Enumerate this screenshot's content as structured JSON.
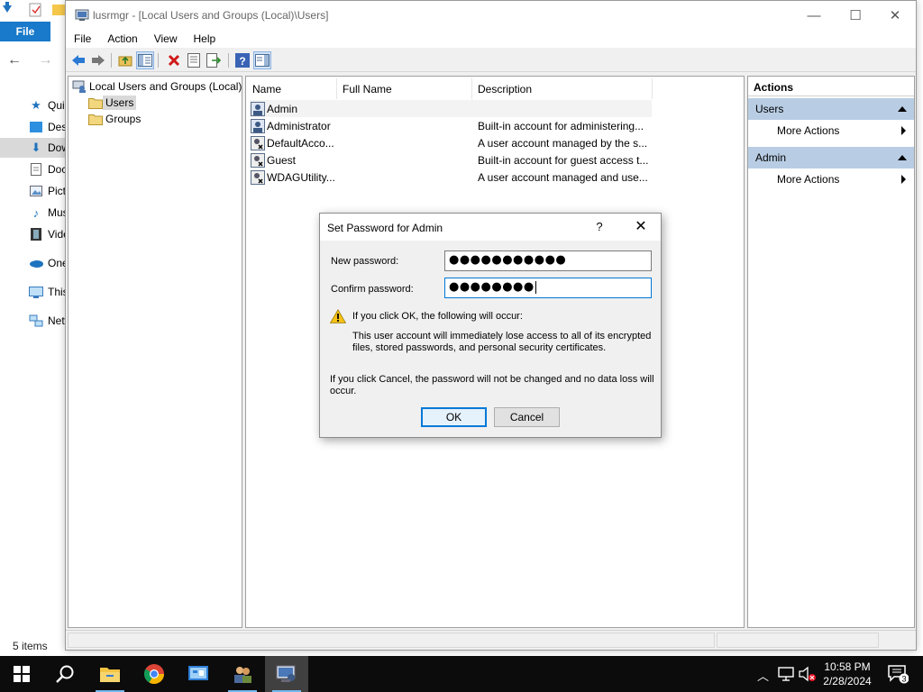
{
  "explorer": {
    "file_tab": "File",
    "status": "5 items",
    "sidebar": [
      {
        "label": "Quick access",
        "icon": "star-icon"
      },
      {
        "label": "Desktop",
        "icon": "desktop-folder-icon"
      },
      {
        "label": "Downloads",
        "icon": "downloads-icon"
      },
      {
        "label": "Documents",
        "icon": "documents-icon"
      },
      {
        "label": "Pictures",
        "icon": "pictures-icon"
      },
      {
        "label": "Music",
        "icon": "music-icon"
      },
      {
        "label": "Videos",
        "icon": "videos-icon"
      },
      {
        "label": "OneDrive",
        "icon": "onedrive-icon"
      },
      {
        "label": "This PC",
        "icon": "this-pc-icon"
      },
      {
        "label": "Network",
        "icon": "network-icon"
      }
    ]
  },
  "window": {
    "title": "lusrmgr - [Local Users and Groups (Local)\\Users]",
    "controls": {
      "minimize": "—",
      "maximize": "☐",
      "close": "✕"
    }
  },
  "menu": [
    "File",
    "Action",
    "View",
    "Help"
  ],
  "tree": {
    "root": "Local Users and Groups (Local)",
    "children": [
      "Users",
      "Groups"
    ]
  },
  "list": {
    "columns": [
      "Name",
      "Full Name",
      "Description"
    ],
    "rows": [
      {
        "name": "Admin",
        "full_name": "",
        "description": ""
      },
      {
        "name": "Administrator",
        "full_name": "",
        "description": "Built-in account for administering..."
      },
      {
        "name": "DefaultAcco...",
        "full_name": "",
        "description": "A user account managed by the s..."
      },
      {
        "name": "Guest",
        "full_name": "",
        "description": "Built-in account for guest access t..."
      },
      {
        "name": "WDAGUtility...",
        "full_name": "",
        "description": "A user account managed and use..."
      }
    ]
  },
  "actions": {
    "header": "Actions",
    "sections": [
      {
        "title": "Users",
        "items": [
          "More Actions"
        ]
      },
      {
        "title": "Admin",
        "items": [
          "More Actions"
        ]
      }
    ]
  },
  "dialog": {
    "title": "Set Password for Admin",
    "help": "?",
    "close": "✕",
    "new_password_label": "New password:",
    "new_password_value": "●●●●●●●●●●●",
    "confirm_password_label": "Confirm password:",
    "confirm_password_value": "●●●●●●●●",
    "warning_heading": "If you click OK, the following will occur:",
    "warning_line1": "This user account will immediately lose access to all of its encrypted",
    "warning_line2": "files, stored passwords, and personal security certificates.",
    "cancel_note_line1": "If you click Cancel, the password will not be changed and no data loss will",
    "cancel_note_line2": "occur.",
    "ok_label": "OK",
    "cancel_label": "Cancel"
  },
  "taskbar": {
    "time": "10:58 PM",
    "date": "2/28/2024",
    "notification_count": "3"
  }
}
